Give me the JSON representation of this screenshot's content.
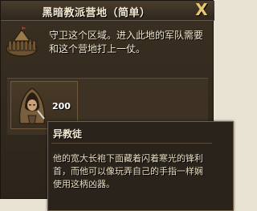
{
  "window": {
    "title": "黑暗教派营地（简单）",
    "close_label": "X"
  },
  "camp": {
    "description": "守卫这个区域。进入此地的军队需要和这个营地打上一仗。"
  },
  "enemy": {
    "unit_count": "200",
    "unit_name": "异教徒",
    "unit_description": "他的宽大长袍下面藏着闪着寒光的锋利\n首，而他可以像玩弄自己的手指一样娴\n使用这柄凶器。"
  },
  "icons": {
    "close": "close-icon",
    "camp": "camp-icon",
    "unit": "heretic-portrait-icon"
  }
}
